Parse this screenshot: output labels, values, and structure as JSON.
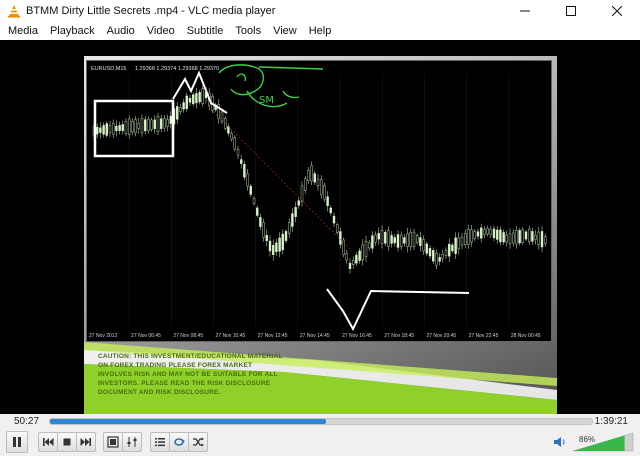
{
  "window": {
    "title": "BTMM Dirty Little Secrets .mp4 - VLC media player"
  },
  "menu": [
    {
      "key": "media",
      "label": "Media"
    },
    {
      "key": "playback",
      "label": "Playback"
    },
    {
      "key": "audio",
      "label": "Audio"
    },
    {
      "key": "video",
      "label": "Video"
    },
    {
      "key": "subtitle",
      "label": "Subtitle"
    },
    {
      "key": "tools",
      "label": "Tools"
    },
    {
      "key": "view",
      "label": "View"
    },
    {
      "key": "help",
      "label": "Help"
    }
  ],
  "video_frame": {
    "chart_symbol": "EURUSD,M15",
    "chart_quotes": "1.29368 1.29374 1.29368 1.29370",
    "time_labels": [
      "27 Nov 2012",
      "27 Nov 06:45",
      "27 Nov 08:45",
      "27 Nov 10:45",
      "27 Nov 12:45",
      "27 Nov 14:45",
      "27 Nov 16:45",
      "27 Nov 18:45",
      "27 Nov 20:45",
      "27 Nov 22:45",
      "28 Nov 00:45"
    ],
    "handwritten_note": "SM",
    "slide_text": "CAUTION: THIS INVESTMENT/EDUCATIONAL MATERIAL ON FOREX TRADING PLEASE FOREX MARKET INVOLVES RISK AND MAY NOT BE SUITABLE FOR ALL INVESTORS. PLEASE READ THE RISK DISCLOSURE DOCUMENT AND RISK DISCLOSURE."
  },
  "playback": {
    "elapsed": "50:27",
    "total": "1:39:21",
    "progress_fraction": 0.51
  },
  "volume": {
    "percent_label": "86%",
    "level_fraction": 0.86
  },
  "colors": {
    "accent": "#2f86d6",
    "volume_green": "#36b84a",
    "chart_candle": "#d8f2c8",
    "annotation_green": "#3fcf4a",
    "annotation_white": "#ffffff"
  }
}
